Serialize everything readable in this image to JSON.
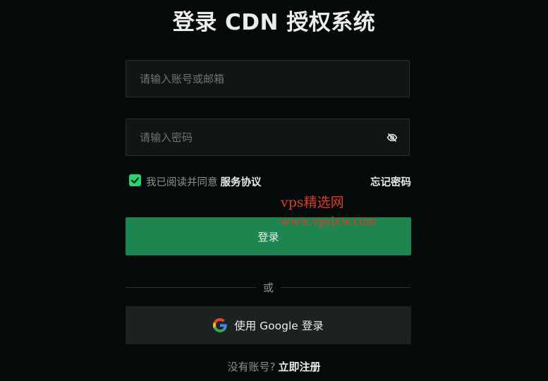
{
  "header": {
    "title": "登录 CDN 授权系统"
  },
  "form": {
    "account_placeholder": "请输入账号或邮箱",
    "account_value": "",
    "password_placeholder": "请输入密码",
    "password_value": "",
    "password_toggle_icon": "eye-off-icon",
    "agree_checked": true,
    "agree_text": "我已阅读并同意",
    "agree_link": "服务协议",
    "forgot_link": "忘记密码",
    "login_label": "登录"
  },
  "divider": {
    "label": "或"
  },
  "google": {
    "icon": "google-logo-icon",
    "label": "使用 Google 登录"
  },
  "register": {
    "question": "没有账号?",
    "link": "立即注册"
  },
  "watermark": {
    "site_name": "vps精选网",
    "site_url": "www.vpsjxw.com"
  },
  "colors": {
    "background": "#050b0a",
    "primary_button": "#1e8550",
    "checkbox": "#2fcf74",
    "watermark": "#e03a2b"
  }
}
